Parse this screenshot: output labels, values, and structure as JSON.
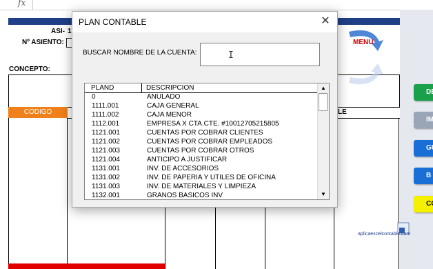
{
  "formula_bar": {
    "fx": "fx"
  },
  "sheet": {
    "asiento_prefix": "ASI-",
    "asiento_digit": "1",
    "num_asiento_label": "Nº ASIENTO:",
    "concepto_label": "CONCEPTO:",
    "codigo_header": "CODIGO",
    "col_header_partial": "LE",
    "menu_label": "MENU",
    "logo_text": "aplicaexcelcontable.com"
  },
  "right_buttons": [
    {
      "label": "DE",
      "color": "#1aa04a"
    },
    {
      "label": "IM",
      "color": "#9aa6b8"
    },
    {
      "label": "GU",
      "color": "#1a6fd6"
    },
    {
      "label": "B",
      "color": "#1a6fd6"
    },
    {
      "label": "CON",
      "color": "#f5f000"
    }
  ],
  "dialog": {
    "title": "PLAN CONTABLE",
    "close_glyph": "✕",
    "search_label": "BUSCAR NOMBRE DE LA CUENTA:",
    "search_value": "",
    "columns": [
      "PLAND",
      "DESCRIPCION"
    ],
    "rows": [
      [
        "0",
        "ANULADO"
      ],
      [
        "1111.001",
        "CAJA GENERAL"
      ],
      [
        "1111.002",
        "CAJA MENOR"
      ],
      [
        "1112.001",
        "EMPRESA X  CTA.CTE. #10012705215805"
      ],
      [
        "1121.001",
        "CUENTAS POR COBRAR CLIENTES"
      ],
      [
        "1121.002",
        "CUENTAS POR COBRAR EMPLEADOS"
      ],
      [
        "1121.003",
        "CUENTAS POR COBRAR OTROS"
      ],
      [
        "1121.004",
        "ANTICIPO A JUSTIFICAR"
      ],
      [
        "1131.001",
        "INV. DE ACCESORIOS"
      ],
      [
        "1131.002",
        "INV. DE PAPERIA Y UTILES  DE OFICINA"
      ],
      [
        "1131.003",
        "INV. DE MATERIALES Y LIMPIEZA"
      ],
      [
        "1132.001",
        "GRANOS BASICOS INV"
      ]
    ]
  }
}
